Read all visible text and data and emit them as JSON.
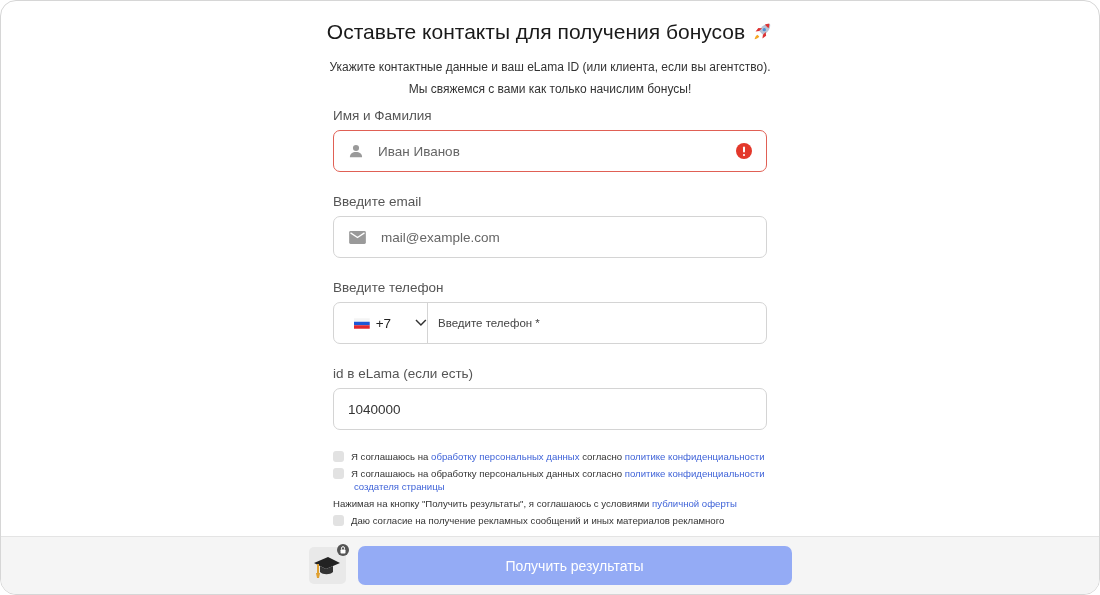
{
  "title": "Оставьте контакты для получения бонусов",
  "subtitle_lines": [
    "Укажите контактные данные и ваш eLama ID (или клиента, если вы агентство).",
    "Мы свяжемся с вами как только начислим бонусы!"
  ],
  "fields": [
    {
      "kind": "name",
      "label": "Имя и Фамилия",
      "placeholder": "Иван Иванов",
      "error": true
    },
    {
      "kind": "email",
      "label": "Введите email",
      "placeholder": "mail@example.com",
      "error": false
    },
    {
      "kind": "phone",
      "label": "Введите телефон",
      "country_code": "+7",
      "placeholder": "Введите телефон *",
      "error": false
    },
    {
      "kind": "text",
      "label": "id в eLama (если есть)",
      "value": "1040000",
      "error": false
    }
  ],
  "agreements": [
    {
      "kind": "checkbox",
      "checked": false,
      "parts": [
        {
          "kind": "text",
          "text": "Я соглашаюсь на "
        },
        {
          "kind": "link",
          "text": "обработку персональных данных"
        },
        {
          "kind": "text",
          "text": " согласно "
        },
        {
          "kind": "link",
          "text": "политике конфиденциальности"
        }
      ]
    },
    {
      "kind": "checkbox",
      "checked": false,
      "parts": [
        {
          "kind": "text",
          "text": "Я соглашаюсь на обработку персональных данных согласно "
        },
        {
          "kind": "link",
          "text": "политике конфиденциальности"
        },
        {
          "kind": "link",
          "text": "создателя страницы"
        }
      ]
    },
    {
      "kind": "note",
      "parts": [
        {
          "kind": "text",
          "text": "Нажимая на кнопку \"Получить результаты\", я соглашаюсь с условиями "
        },
        {
          "kind": "link",
          "text": "публичной оферты"
        }
      ]
    },
    {
      "kind": "checkbox",
      "checked": false,
      "parts": [
        {
          "kind": "text",
          "text": "Даю согласие на получение рекламных сообщений и иных материалов рекламного"
        }
      ]
    }
  ],
  "submit": {
    "label": "Получить результаты",
    "disabled": true
  }
}
